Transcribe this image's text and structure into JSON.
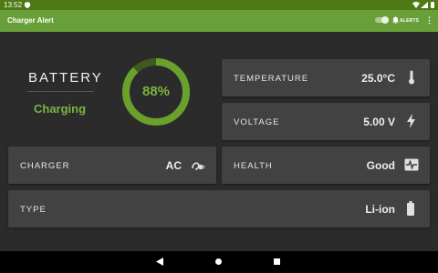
{
  "status_bar": {
    "time": "13:52",
    "icons": [
      "alert-shield-icon",
      "wifi-icon",
      "signal-icon",
      "battery-icon"
    ]
  },
  "app_bar": {
    "title": "Charger Alert",
    "alerts_label": "ALERTS",
    "alerts_toggle_on": true
  },
  "battery": {
    "label": "BATTERY",
    "status": "Charging",
    "level_percent": 88,
    "level_text": "88%"
  },
  "cards": {
    "temperature": {
      "label": "TEMPERATURE",
      "value": "25.0°C",
      "icon": "thermometer-icon"
    },
    "voltage": {
      "label": "VOLTAGE",
      "value": "5.00 V",
      "icon": "lightning-icon"
    },
    "charger": {
      "label": "CHARGER",
      "value": "AC",
      "icon": "power-plug-icon"
    },
    "health": {
      "label": "HEALTH",
      "value": "Good",
      "icon": "heart-pulse-icon"
    },
    "type": {
      "label": "TYPE",
      "value": "Li-ion",
      "icon": "battery-icon"
    }
  },
  "colors": {
    "accent": "#7cb342",
    "app_bar": "#689f38",
    "status_bar": "#4e7a16",
    "background": "#2b2b2b",
    "card": "#424242"
  }
}
